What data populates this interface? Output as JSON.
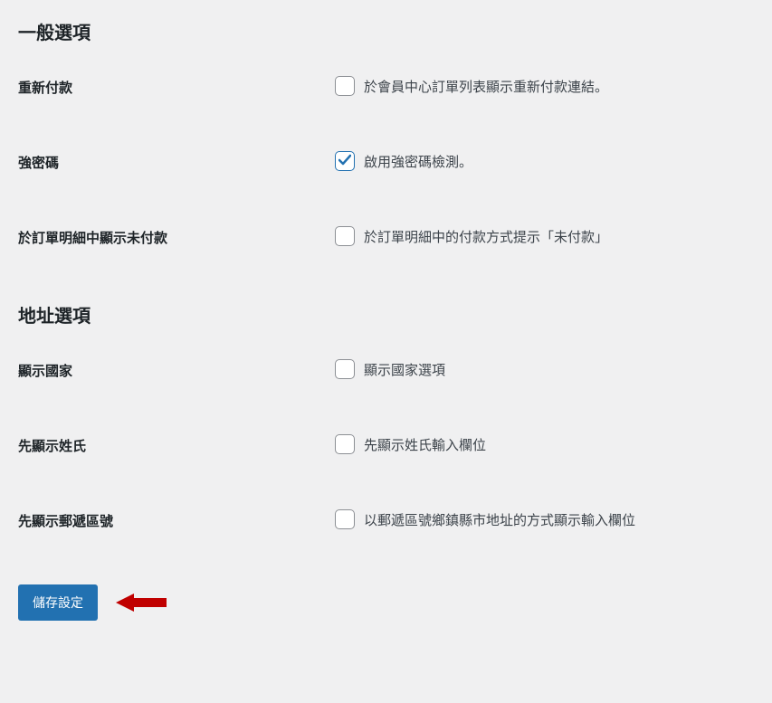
{
  "sections": {
    "general": {
      "title": "一般選項",
      "items": [
        {
          "label": "重新付款",
          "desc": "於會員中心訂單列表顯示重新付款連結。",
          "checked": false
        },
        {
          "label": "強密碼",
          "desc": "啟用強密碼檢測。",
          "checked": true
        },
        {
          "label": "於訂單明細中顯示未付款",
          "desc": "於訂單明細中的付款方式提示「未付款」",
          "checked": false
        }
      ]
    },
    "address": {
      "title": "地址選項",
      "items": [
        {
          "label": "顯示國家",
          "desc": "顯示國家選項",
          "checked": false
        },
        {
          "label": "先顯示姓氏",
          "desc": "先顯示姓氏輸入欄位",
          "checked": false
        },
        {
          "label": "先顯示郵遞區號",
          "desc": "以郵遞區號鄉鎮縣市地址的方式顯示輸入欄位",
          "checked": false
        }
      ]
    }
  },
  "save_button_label": "儲存設定",
  "arrow_color": "#c00000"
}
